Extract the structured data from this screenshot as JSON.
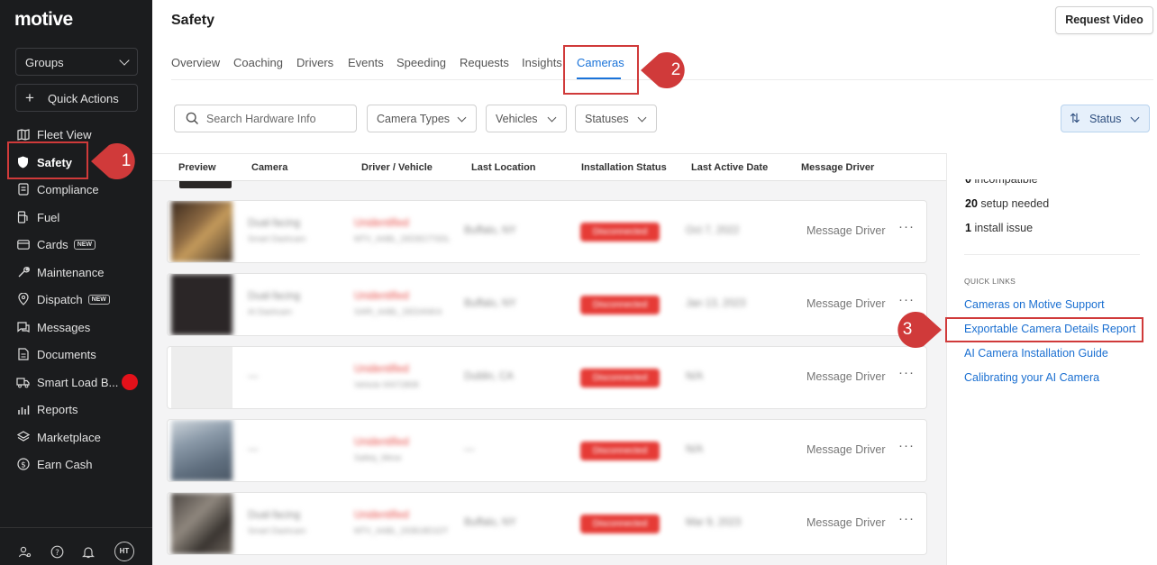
{
  "app": {
    "logo": "motive"
  },
  "sidebar": {
    "groups_label": "Groups",
    "quick_actions_label": "Quick Actions",
    "items": [
      {
        "label": "Fleet View",
        "icon": "map-icon"
      },
      {
        "label": "Safety",
        "icon": "shield-icon"
      },
      {
        "label": "Compliance",
        "icon": "document-icon"
      },
      {
        "label": "Fuel",
        "icon": "fuel-pump-icon"
      },
      {
        "label": "Cards",
        "icon": "card-icon",
        "badge": "NEW"
      },
      {
        "label": "Maintenance",
        "icon": "wrench-icon"
      },
      {
        "label": "Dispatch",
        "icon": "location-pin-icon",
        "badge": "NEW"
      },
      {
        "label": "Messages",
        "icon": "chat-icon"
      },
      {
        "label": "Documents",
        "icon": "file-icon"
      },
      {
        "label": "Smart Load B...",
        "icon": "truck-icon"
      },
      {
        "label": "Reports",
        "icon": "bar-chart-icon"
      },
      {
        "label": "Marketplace",
        "icon": "layers-icon"
      },
      {
        "label": "Earn Cash",
        "icon": "dollar-icon"
      }
    ],
    "avatar_initials": "HT"
  },
  "header": {
    "title": "Safety",
    "request_video_label": "Request Video",
    "tabs": [
      "Overview",
      "Coaching",
      "Drivers",
      "Events",
      "Speeding",
      "Requests",
      "Insights",
      "Cameras"
    ],
    "active_tab": "Cameras"
  },
  "filters": {
    "search_placeholder": "Search Hardware Info",
    "camera_types": "Camera Types",
    "vehicles": "Vehicles",
    "statuses": "Statuses",
    "sort_label": "Status"
  },
  "table": {
    "columns": [
      "Preview",
      "Camera",
      "Driver / Vehicle",
      "Last Location",
      "Installation Status",
      "Last Active Date",
      "Message Driver"
    ],
    "rows": [
      {
        "camera": "Dual-facing",
        "camera_sub": "Smart Dashcam",
        "driver": "Unidentified",
        "vehicle": "MTV_AABL_DEDECTSDL",
        "location": "Buffalo, NY",
        "status": "Disconnected",
        "date": "Oct 7, 2022",
        "message": "Message Driver"
      },
      {
        "camera": "Dual-facing",
        "camera_sub": "AI Dashcam",
        "driver": "Unidentified",
        "vehicle": "SARI_AABL_DEDANKA",
        "location": "Buffalo, NY",
        "status": "Disconnected",
        "date": "Jan 13, 2023",
        "message": "Message Driver"
      },
      {
        "camera": "—",
        "camera_sub": "",
        "driver": "Unidentified",
        "vehicle": "Vehicle 00072808",
        "location": "Dublin, CA",
        "status": "Disconnected",
        "date": "N/A",
        "message": "Message Driver"
      },
      {
        "camera": "—",
        "camera_sub": "",
        "driver": "Unidentified",
        "vehicle": "Safety_Mime",
        "location": "—",
        "status": "Disconnected",
        "date": "N/A",
        "message": "Message Driver"
      },
      {
        "camera": "Dual-facing",
        "camera_sub": "Smart Dashcam",
        "driver": "Unidentified",
        "vehicle": "MTV_AABL_DDB18D1DT",
        "location": "Buffalo, NY",
        "status": "Disconnected",
        "date": "Mar 9, 2023",
        "message": "Message Driver"
      }
    ],
    "actions_glyph": "···"
  },
  "summary": {
    "incompatible_count": "0",
    "incompatible_label": "incompatible",
    "setup_count": "20",
    "setup_label": "setup needed",
    "install_count": "1",
    "install_label": "install issue"
  },
  "quick_links": {
    "title": "QUICK LINKS",
    "links": [
      "Cameras on Motive Support",
      "Exportable Camera Details Report",
      "AI Camera Installation Guide",
      "Calibrating your AI Camera"
    ]
  },
  "annotations": {
    "callout_1": "1",
    "callout_2": "2",
    "callout_3": "3",
    "color": "#d03a3a"
  }
}
